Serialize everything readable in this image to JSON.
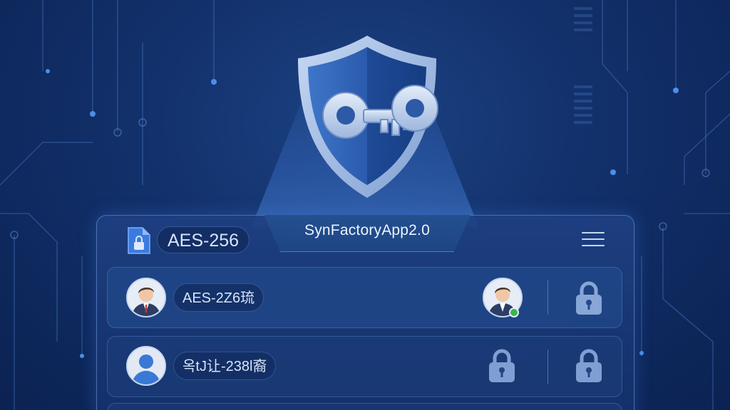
{
  "header": {
    "app_title": "SynFactoryApp2.0",
    "encryption_badge": "AES-256",
    "file_icon": "lock-file-icon",
    "menu_icon": "hamburger-menu-icon"
  },
  "hero": {
    "icon": "shield-key-icon"
  },
  "rows": [
    {
      "label": "AES-2Z6琉",
      "avatar_icon": "person-avatar-icon",
      "secondary_avatar_icon": "person-avatar-icon",
      "status": "online",
      "lock_icon": "lock-icon"
    },
    {
      "label": "옥tJ让-238l裔",
      "avatar_icon": "generic-user-icon",
      "secondary_lock_icon": "lock-icon",
      "lock_icon": "lock-icon"
    }
  ],
  "colors": {
    "background": "#12306a",
    "accent": "#4c8fe8",
    "status_online": "#3bb54a",
    "lock": "#7f9fd3"
  }
}
